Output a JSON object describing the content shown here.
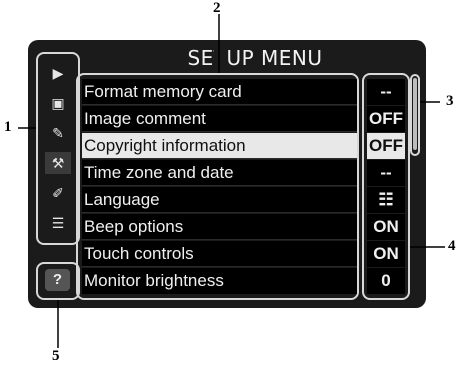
{
  "menu": {
    "title": "SETUP MENU",
    "items": [
      {
        "label": "Format memory card",
        "value": "--"
      },
      {
        "label": "Image comment",
        "value": "OFF"
      },
      {
        "label": "Copyright information",
        "value": "OFF",
        "selected": true
      },
      {
        "label": "Time zone and date",
        "value": "--"
      },
      {
        "label": "Language",
        "value": "☷"
      },
      {
        "label": "Beep options",
        "value": "ON"
      },
      {
        "label": "Touch controls",
        "value": "ON"
      },
      {
        "label": "Monitor brightness",
        "value": "0"
      }
    ]
  },
  "tabs": [
    {
      "icon": "playback-icon",
      "glyph": "▶"
    },
    {
      "icon": "camera-icon",
      "glyph": "▣"
    },
    {
      "icon": "pencil-icon",
      "glyph": "✎"
    },
    {
      "icon": "wrench-icon",
      "glyph": "⚒"
    },
    {
      "icon": "retouch-icon",
      "glyph": "✐"
    },
    {
      "icon": "my-menu-icon",
      "glyph": "☰"
    }
  ],
  "help": {
    "glyph": "?"
  },
  "callouts": {
    "c1": "1",
    "c2": "2",
    "c3": "3",
    "c4": "4",
    "c5": "5"
  }
}
